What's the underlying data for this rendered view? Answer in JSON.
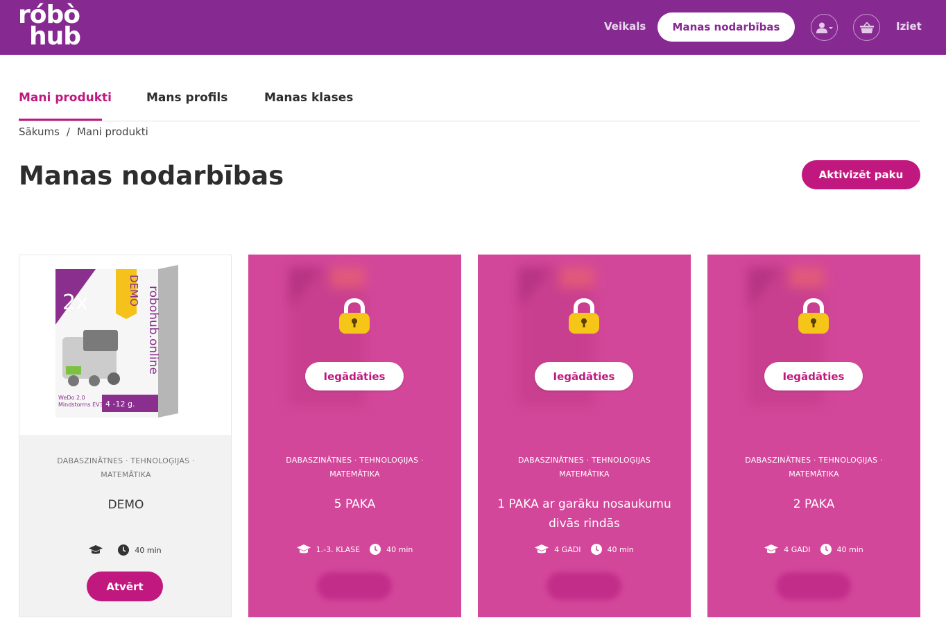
{
  "header": {
    "logo_line1": "róbò",
    "logo_line2": "hub",
    "store_label": "Veikals",
    "active_nav_label": "Manas nodarbības",
    "logout_label": "Iziet"
  },
  "tabs": [
    {
      "label": "Mani produkti",
      "active": true
    },
    {
      "label": "Mans profils",
      "active": false
    },
    {
      "label": "Manas klases",
      "active": false
    }
  ],
  "breadcrumb": {
    "home": "Sākums",
    "separator": "/",
    "current": "Mani produkti"
  },
  "page": {
    "title": "Manas nodarbības",
    "activate_label": "Aktivizēt paku"
  },
  "cards": [
    {
      "tags_line1": "DABASZINĀTNES · TEHNOLOĢIJAS ·",
      "tags_line2": "MATEMĀTIKA",
      "title": "DEMO",
      "grade": "",
      "duration": "40 min",
      "action": "Atvērt",
      "locked": false,
      "box": {
        "multiplier": "2x",
        "demo": "DEMO",
        "brand": "robohub.online",
        "line1": "WeDo 2.0",
        "line2": "Mindstorms EV3",
        "age": "4 -12 g."
      }
    },
    {
      "tags_line1": "DABASZINĀTNES · TEHNOLOĢIJAS ·",
      "tags_line2": "MATEMĀTIKA",
      "title": "5 PAKA",
      "grade": "1.-3. KLASE",
      "duration": "40 min",
      "action": "Iegādāties",
      "locked": true
    },
    {
      "tags_line1": "DABASZINĀTNES · TEHNOLOĢIJAS",
      "tags_line2": "MATEMĀTIKA",
      "title": "1 PAKA ar garāku nosaukumu divās rindās",
      "grade": "4 GADI",
      "duration": "40 min",
      "action": "Iegādāties",
      "locked": true
    },
    {
      "tags_line1": "DABASZINĀTNES · TEHNOLOĢIJAS ·",
      "tags_line2": "MATEMĀTIKA",
      "title": "2 PAKA",
      "grade": "4 GADI",
      "duration": "40 min",
      "action": "Iegādāties",
      "locked": true
    }
  ],
  "icons": {
    "profile": "user-icon",
    "cart": "basket-icon",
    "grade": "graduation-cap-icon",
    "duration": "clock-icon",
    "locked": "padlock-icon"
  },
  "colors": {
    "header": "#862a92",
    "accent": "#c0187e",
    "locked_card": "#d3479a",
    "demo_card": "#f2f2f2"
  }
}
